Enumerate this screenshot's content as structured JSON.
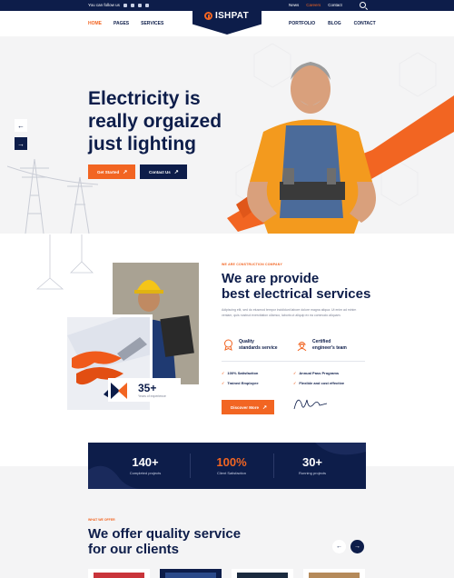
{
  "topbar": {
    "follow_label": "You can follow us",
    "social_icons": [
      "facebook-icon",
      "twitter-icon",
      "instagram-icon",
      "youtube-icon"
    ],
    "links": [
      {
        "label": "News",
        "active": false
      },
      {
        "label": "Careers",
        "active": true
      },
      {
        "label": "Contact",
        "active": false
      }
    ]
  },
  "nav": {
    "left_items": [
      "HOME",
      "PAGES",
      "SERVICES"
    ],
    "right_items": [
      "PORTFOLIO",
      "BLOG",
      "CONTACT"
    ],
    "active_item": "HOME",
    "logo_text": "ISHPAT"
  },
  "hero": {
    "title_lines": [
      "Electricity is",
      "really orgaized",
      "just lighting"
    ],
    "primary_button": "Get Started",
    "secondary_button": "Contact Us",
    "button_arrow": "↗",
    "prev_arrow": "←",
    "next_arrow": "→"
  },
  "about": {
    "tag": "WE ARE CONSTRUCTION COMPANY",
    "title_lines": [
      "We are provide",
      "best electrical services"
    ],
    "description": "Adipiscing elit, sed do eiusmod tempor incididunt labore dolore magna aliqua. Ut enim ad minim veniam, quis nostrud exercitation ullamco, laboris ut aliquip ex ea commodo aliquam.",
    "features": [
      {
        "line1": "Quality",
        "line2": "standards service",
        "icon": "quality-badge-icon"
      },
      {
        "line1": "Certified",
        "line2": "engineer's team",
        "icon": "engineer-icon"
      }
    ],
    "checks": [
      "100% Satisfaction",
      "Annual Pass Programs",
      "Trained Employee",
      "Flexible and cost effective"
    ],
    "button": "Discover More",
    "button_arrow": "↗",
    "stat_value": "35+",
    "stat_label": "Years of experience"
  },
  "counter": {
    "items": [
      {
        "value": "140+",
        "label": "Completed projects",
        "highlight": false
      },
      {
        "value": "100%",
        "label": "Client Satisfaction",
        "highlight": true
      },
      {
        "value": "30+",
        "label": "Running projects",
        "highlight": false
      }
    ]
  },
  "services": {
    "tag": "WHAT WE OFFER",
    "title_lines": [
      "We offer quality service",
      "for our clients"
    ],
    "prev_arrow": "←",
    "next_arrow": "→"
  },
  "colors": {
    "navy": "#0d1d4a",
    "orange": "#f26522",
    "light_bg": "#f4f4f5"
  }
}
